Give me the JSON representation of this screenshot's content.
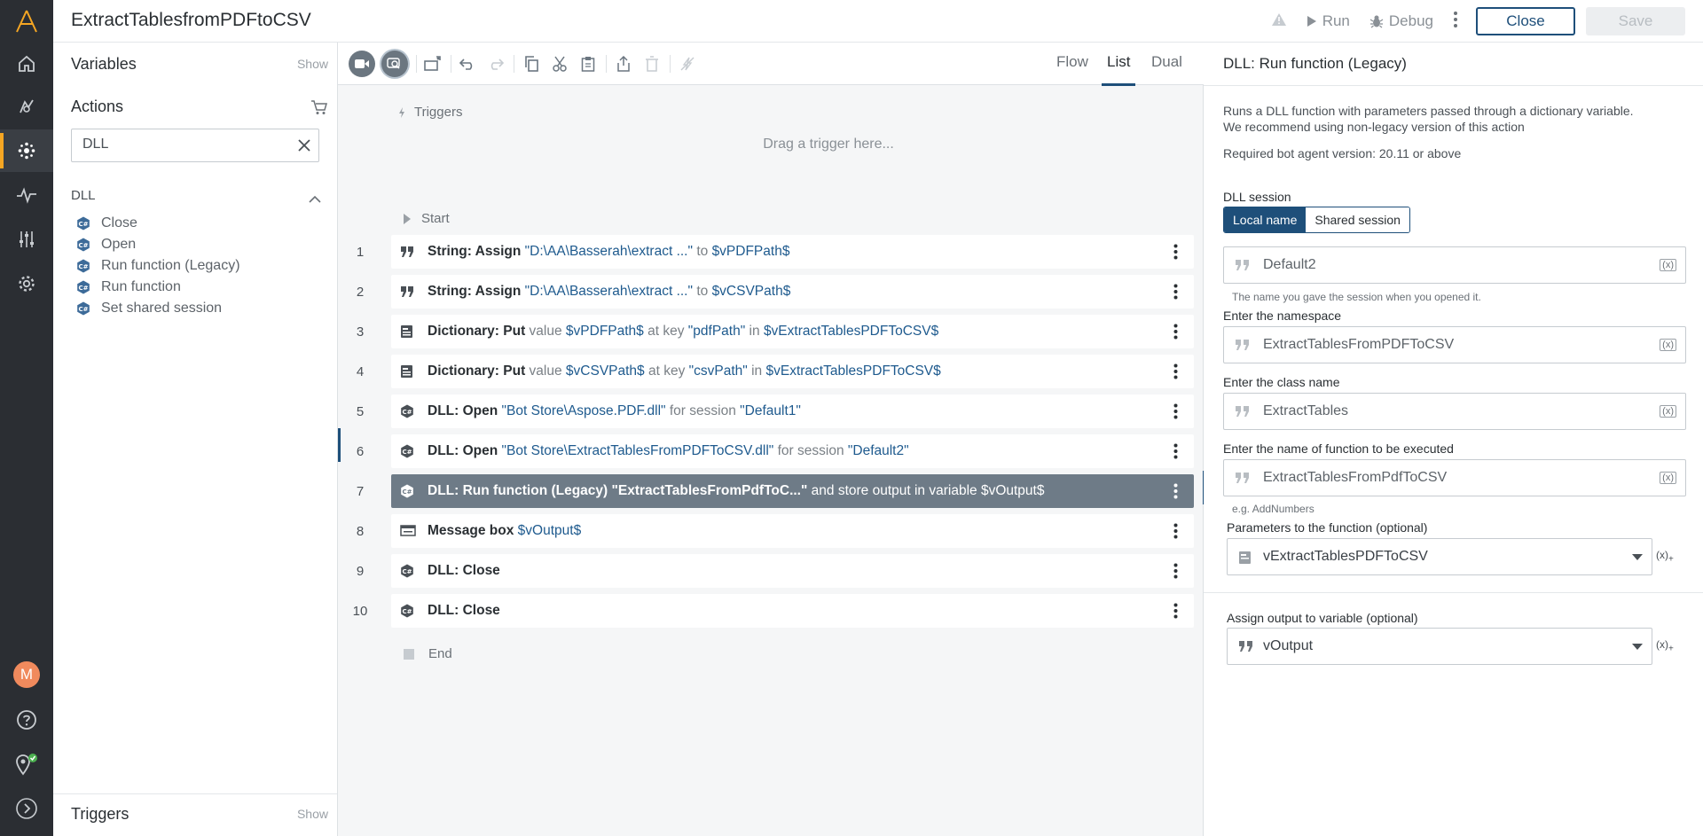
{
  "header": {
    "title": "ExtractTablesfromPDFtoCSV",
    "run_label": "Run",
    "debug_label": "Debug",
    "close_label": "Close",
    "save_label": "Save"
  },
  "palette": {
    "variables_title": "Variables",
    "variables_show": "Show",
    "actions_title": "Actions",
    "search_value": "DLL",
    "group_title": "DLL",
    "items": [
      {
        "label": "Close"
      },
      {
        "label": "Open"
      },
      {
        "label": "Run function (Legacy)"
      },
      {
        "label": "Run function"
      },
      {
        "label": "Set shared session"
      }
    ],
    "triggers_title": "Triggers",
    "triggers_show": "Show"
  },
  "editor": {
    "views": {
      "flow": "Flow",
      "list": "List",
      "dual": "Dual"
    },
    "triggers_label": "Triggers",
    "drag_hint": "Drag a trigger here...",
    "start_label": "Start",
    "end_label": "End",
    "rows": [
      {
        "num": "1",
        "action": "String: Assign",
        "p1": "\"D:\\AA\\Basserah\\extract ...\"",
        "m1": "to",
        "p2": "$vPDFPath$"
      },
      {
        "num": "2",
        "action": "String: Assign",
        "p1": "\"D:\\AA\\Basserah\\extract ...\"",
        "m1": "to",
        "p2": "$vCSVPath$"
      },
      {
        "num": "3",
        "action": "Dictionary: Put",
        "m0": "value",
        "p1": "$vPDFPath$",
        "m1": "at key",
        "p2": "\"pdfPath\"",
        "m2": "in",
        "p3": "$vExtractTablesPDFToCSV$"
      },
      {
        "num": "4",
        "action": "Dictionary: Put",
        "m0": "value",
        "p1": "$vCSVPath$",
        "m1": "at key",
        "p2": "\"csvPath\"",
        "m2": "in",
        "p3": "$vExtractTablesPDFToCSV$"
      },
      {
        "num": "5",
        "action": "DLL: Open",
        "p1": "\"Bot Store\\Aspose.PDF.dll\"",
        "m1": "for session",
        "p2": "\"Default1\""
      },
      {
        "num": "6",
        "action": "DLL: Open",
        "p1": "\"Bot Store\\ExtractTablesFromPDFToCSV.dll\"",
        "m1": "for session",
        "p2": "\"Default2\""
      },
      {
        "num": "7",
        "action": "DLL: Run function (Legacy)",
        "p1": "\"ExtractTablesFromPdfToC...\"",
        "m1": "and store output in variable",
        "p2": "$vOutput$"
      },
      {
        "num": "8",
        "action": "Message box",
        "p1": "$vOutput$"
      },
      {
        "num": "9",
        "action": "DLL: Close"
      },
      {
        "num": "10",
        "action": "DLL: Close"
      }
    ]
  },
  "props": {
    "title": "DLL: Run function (Legacy)",
    "desc_line1": "Runs a DLL function with parameters passed through a dictionary variable.",
    "desc_line2": "We recommend using non-legacy version of this action",
    "version": "Required bot agent version: 20.11 or above",
    "session_label": "DLL session",
    "seg_local": "Local name",
    "seg_shared": "Shared session",
    "session_value": "Default2",
    "session_hint": "The name you gave the session when you opened it.",
    "namespace_label": "Enter the namespace",
    "namespace_value": "ExtractTablesFromPDFToCSV",
    "class_label": "Enter the class name",
    "class_value": "ExtractTables",
    "function_label": "Enter the name of function to be executed",
    "function_value": "ExtractTablesFromPdfToCSV",
    "function_hint": "e.g. AddNumbers",
    "params_label": "Parameters to the function (optional)",
    "params_value": "vExtractTablesPDFToCSV",
    "output_label": "Assign output to variable (optional)",
    "output_value": "vOutput"
  },
  "user": {
    "initial": "M"
  },
  "colors": {
    "accent": "#1e4f7a",
    "rail": "#2b2e33",
    "selected_row": "#6e7b87",
    "brand": "#f5a623"
  }
}
